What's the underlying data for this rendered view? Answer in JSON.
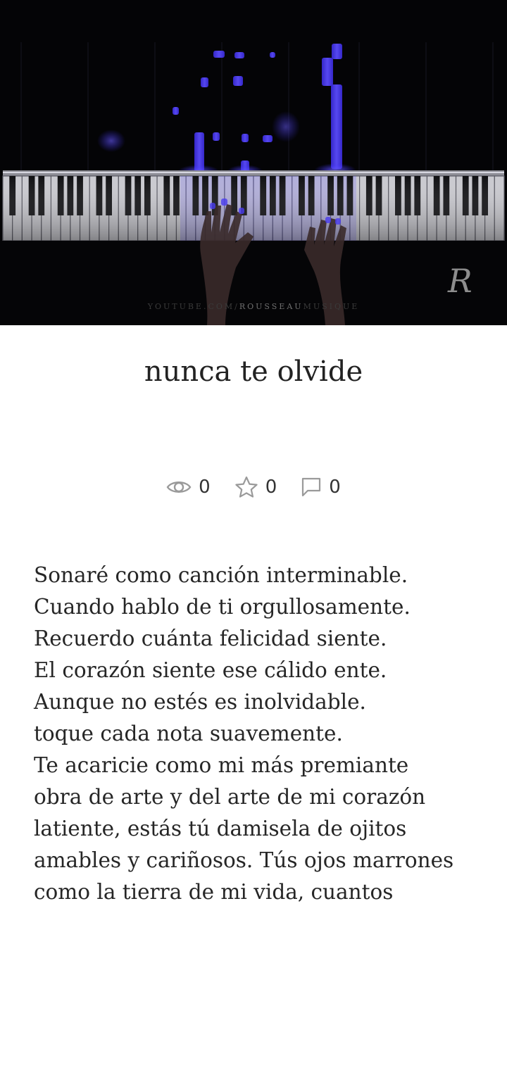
{
  "cover": {
    "watermark_left": "YOUTUBE.COM/",
    "watermark_mid": "ROUSSEAU",
    "watermark_right": "MUSIQUE",
    "logo": "R"
  },
  "post": {
    "title": "nunca te olvide"
  },
  "stats": {
    "views": "0",
    "stars": "0",
    "comments": "0"
  },
  "body_lines": [
    "Sonaré como canción interminable.",
    "Cuando hablo de ti orgullosamente.",
    "Recuerdo cuánta felicidad siente.",
    "El corazón siente ese cálido ente.",
    "Aunque no estés es inolvidable.",
    "toque cada nota suavemente.",
    "Te acaricie como mi más premiante",
    "obra de arte y del arte de mi corazón",
    "latiente, estás tú damisela de ojitos",
    "amables y cariñosos. Tús ojos marrones",
    "como la tierra de mi vida, cuantos"
  ],
  "icons": {
    "views": "eye-icon",
    "stars": "star-icon",
    "comments": "comment-icon"
  }
}
